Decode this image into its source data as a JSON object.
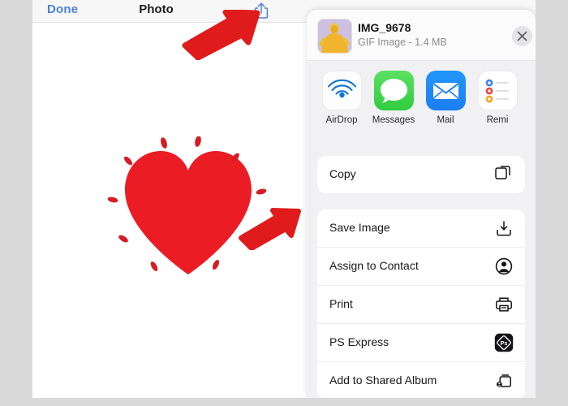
{
  "page": {
    "background_color": "#d9d9d9",
    "content_background": "#ffffff"
  },
  "navbar": {
    "done_label": "Done",
    "title": "Photo",
    "share_icon": "share-up-arrow-icon",
    "done_color": "#4c82d6"
  },
  "photo": {
    "artwork_name": "red-heart-illustration",
    "heart_color": "#ec1c24"
  },
  "share_sheet": {
    "file": {
      "name": "IMG_9678",
      "subtitle": "GIF Image - 1.4 MB",
      "thumbnail_name": "person-yellow-hoodie-thumbnail"
    },
    "close_label": "✕",
    "apps": [
      {
        "label": "AirDrop",
        "icon": "airdrop-icon",
        "color": "#ffffff"
      },
      {
        "label": "Messages",
        "icon": "messages-icon",
        "color": "#36cc43"
      },
      {
        "label": "Mail",
        "icon": "mail-icon",
        "color": "#1b83f4"
      },
      {
        "label": "Remi",
        "icon": "reminders-icon",
        "color": "#ffffff"
      }
    ],
    "action_group_1": [
      {
        "label": "Copy",
        "icon": "copy-pages-icon"
      }
    ],
    "action_group_2": [
      {
        "label": "Save Image",
        "icon": "save-download-icon"
      },
      {
        "label": "Assign to Contact",
        "icon": "contact-person-icon"
      },
      {
        "label": "Print",
        "icon": "printer-icon"
      },
      {
        "label": "PS Express",
        "icon": "ps-express-app-icon"
      },
      {
        "label": "Add to Shared Album",
        "icon": "shared-album-icon"
      }
    ]
  },
  "annotations": {
    "arrow_color": "#e01b1b",
    "arrows": [
      {
        "name": "arrow-pointing-to-share-button",
        "target": "share_icon"
      },
      {
        "name": "arrow-pointing-to-save-image",
        "target": "save_image_row"
      }
    ]
  }
}
